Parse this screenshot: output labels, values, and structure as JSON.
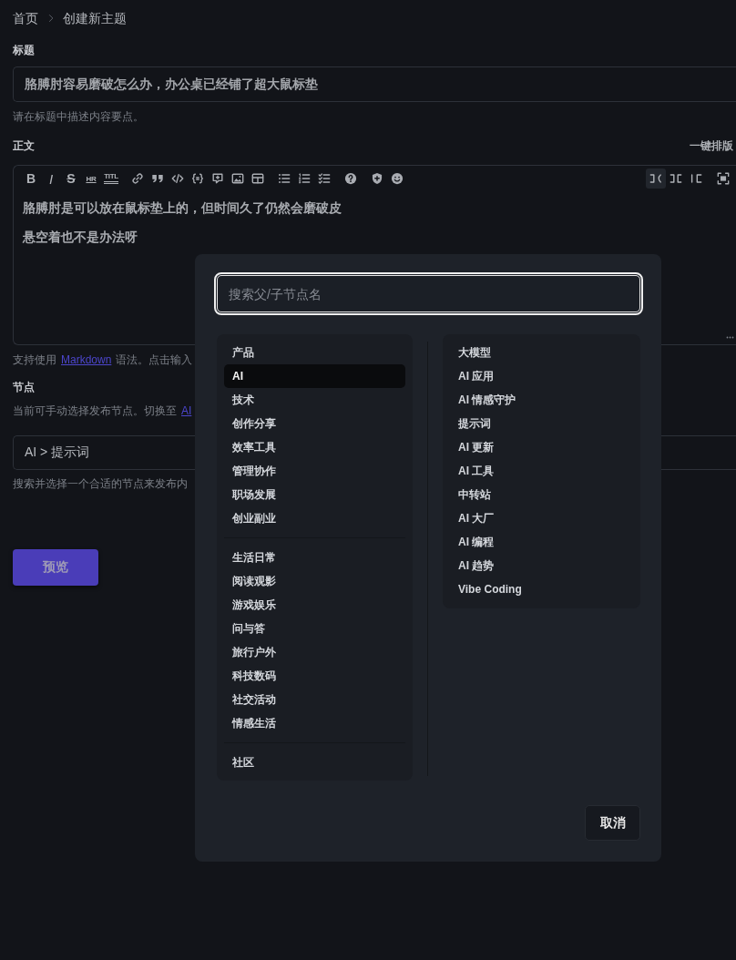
{
  "breadcrumb": [
    "首页",
    "创建新主题"
  ],
  "title_field": {
    "label": "标题",
    "value": "胳膊肘容易磨破怎么办，办公桌已经铺了超大鼠标垫",
    "hint": "请在标题中描述内容要点。"
  },
  "body_field": {
    "label": "正文",
    "action": "一键排版",
    "format_buttons": [
      "B",
      "I",
      "S",
      "HR",
      "TITL"
    ],
    "view_modes": [
      {
        "selected": true
      },
      {
        "selected": false
      },
      {
        "selected": false
      }
    ],
    "paragraphs": [
      "胳膊肘是可以放在鼠标垫上的，但时间久了仍然会磨破皮",
      "悬空着也不是办法呀"
    ],
    "hint": {
      "before": "支持使用",
      "link": "Markdown",
      "after": "语法。点击输入"
    }
  },
  "node_field": {
    "label": "节点",
    "note": {
      "before": "当前可手动选择发布节点。切换至",
      "link": "AI"
    },
    "value": "AI > 提示词",
    "hint": "搜索并选择一个合适的节点来发布内"
  },
  "preview_button": "预览",
  "node_picker": {
    "search": {
      "placeholder": "搜索父/子节点名"
    },
    "parent_groups": [
      {
        "items": [
          {
            "label": "产品",
            "selected": false
          },
          {
            "label": "AI",
            "selected": true
          },
          {
            "label": "技术",
            "selected": false
          },
          {
            "label": "创作分享",
            "selected": false
          },
          {
            "label": "效率工具",
            "selected": false
          },
          {
            "label": "管理协作",
            "selected": false
          },
          {
            "label": "职场发展",
            "selected": false
          },
          {
            "label": "创业副业",
            "selected": false
          }
        ]
      },
      {
        "items": [
          {
            "label": "生活日常",
            "selected": false
          },
          {
            "label": "阅读观影",
            "selected": false
          },
          {
            "label": "游戏娱乐",
            "selected": false
          },
          {
            "label": "问与答",
            "selected": false
          },
          {
            "label": "旅行户外",
            "selected": false
          },
          {
            "label": "科技数码",
            "selected": false
          },
          {
            "label": "社交活动",
            "selected": false
          },
          {
            "label": "情感生活",
            "selected": false
          }
        ]
      },
      {
        "items": [
          {
            "label": "社区",
            "selected": false
          }
        ]
      }
    ],
    "child_nodes": [
      {
        "label": "大模型",
        "selected": false
      },
      {
        "label": "AI 应用",
        "selected": false
      },
      {
        "label": "AI 情感守护",
        "selected": false
      },
      {
        "label": "提示词",
        "selected": false
      },
      {
        "label": "AI 更新",
        "selected": false
      },
      {
        "label": "AI 工具",
        "selected": false
      },
      {
        "label": "中转站",
        "selected": false
      },
      {
        "label": "AI 大厂",
        "selected": false
      },
      {
        "label": "AI 编程",
        "selected": false
      },
      {
        "label": "AI 趋势",
        "selected": false
      },
      {
        "label": "Vibe Coding",
        "selected": false
      }
    ],
    "cancel_button": "取消"
  }
}
